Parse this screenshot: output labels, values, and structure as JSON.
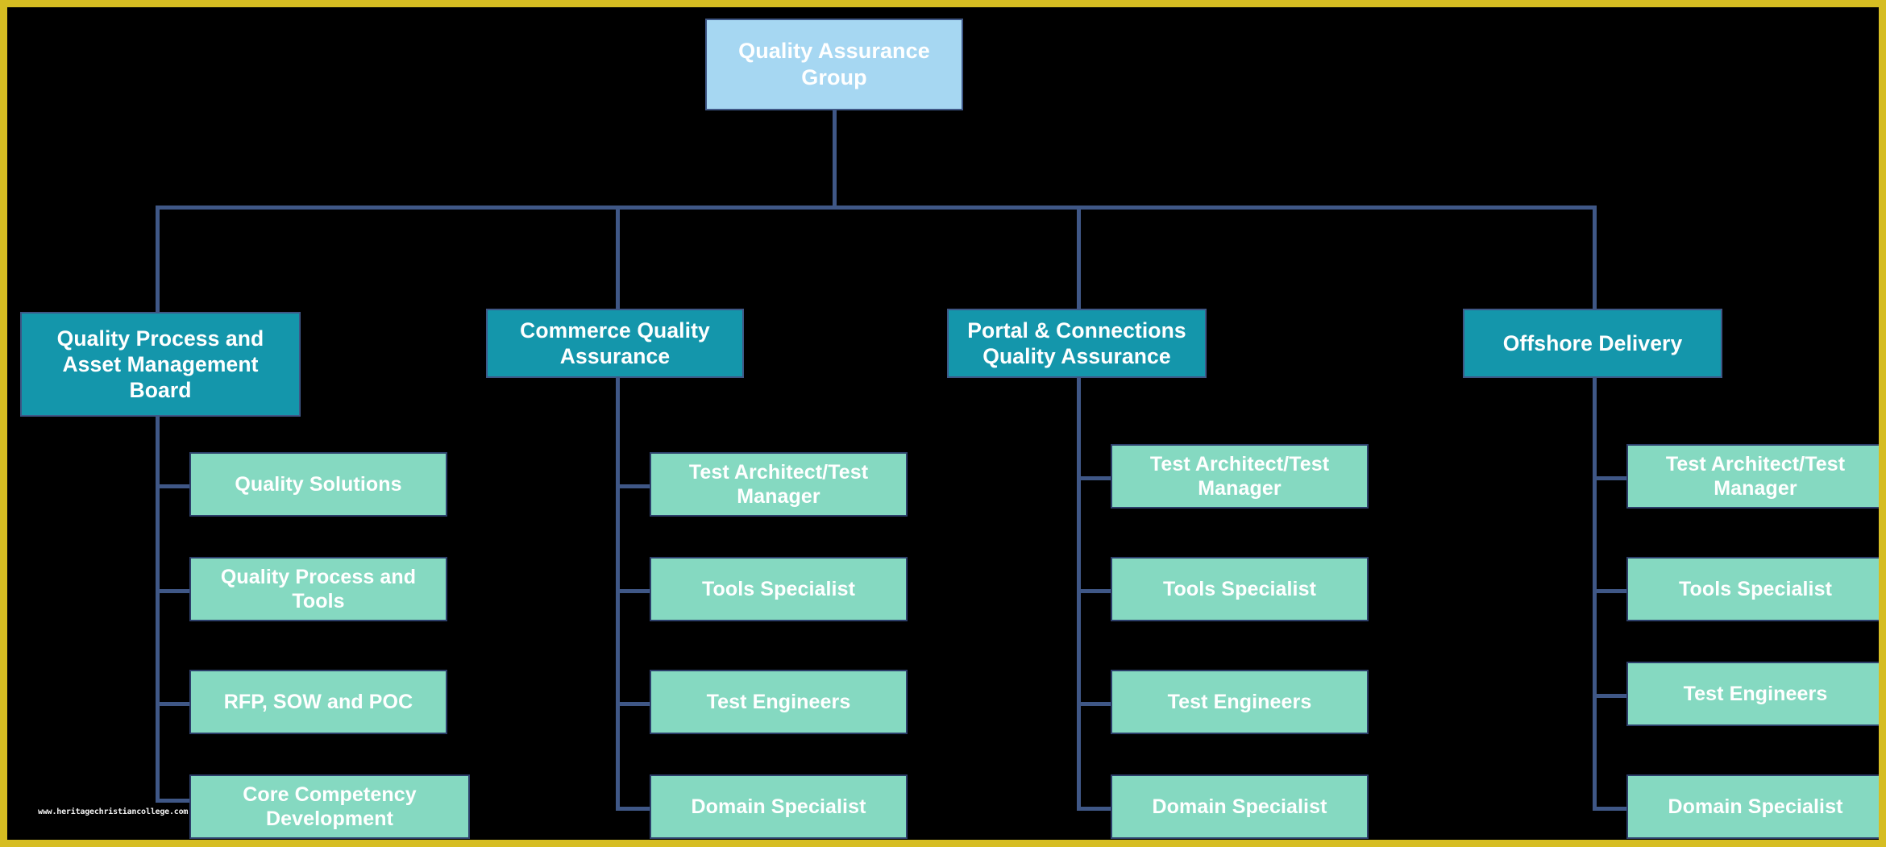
{
  "diagram": {
    "type": "organizational-chart",
    "background_color": "#000000",
    "frame_color": "#d6bd22",
    "connector_color": "#3f5786",
    "root": {
      "label": "Quality Assurance Group",
      "color": "#a6d7f2",
      "text_color": "#ffffff"
    },
    "divisions": [
      {
        "label": "Quality Process and Asset Management Board",
        "color": "#1496ab",
        "children": [
          {
            "label": "Quality Solutions",
            "color": "#85d9c1"
          },
          {
            "label": "Quality Process and Tools",
            "color": "#85d9c1"
          },
          {
            "label": "RFP, SOW and POC",
            "color": "#85d9c1"
          },
          {
            "label": "Core Competency Development",
            "color": "#85d9c1"
          }
        ]
      },
      {
        "label": "Commerce Quality Assurance",
        "color": "#1496ab",
        "children": [
          {
            "label": "Test Architect/Test Manager",
            "color": "#85d9c1"
          },
          {
            "label": "Tools Specialist",
            "color": "#85d9c1"
          },
          {
            "label": "Test Engineers",
            "color": "#85d9c1"
          },
          {
            "label": "Domain Specialist",
            "color": "#85d9c1"
          }
        ]
      },
      {
        "label": "Portal & Connections Quality Assurance",
        "color": "#1496ab",
        "children": [
          {
            "label": "Test Architect/Test Manager",
            "color": "#85d9c1"
          },
          {
            "label": "Tools Specialist",
            "color": "#85d9c1"
          },
          {
            "label": "Test Engineers",
            "color": "#85d9c1"
          },
          {
            "label": "Domain Specialist",
            "color": "#85d9c1"
          }
        ]
      },
      {
        "label": "Offshore Delivery",
        "color": "#1496ab",
        "children": [
          {
            "label": "Test Architect/Test Manager",
            "color": "#85d9c1"
          },
          {
            "label": "Tools Specialist",
            "color": "#85d9c1"
          },
          {
            "label": "Test Engineers",
            "color": "#85d9c1"
          },
          {
            "label": "Domain Specialist",
            "color": "#85d9c1"
          }
        ]
      }
    ],
    "watermark": "www.heritagechristiancollege.com"
  }
}
